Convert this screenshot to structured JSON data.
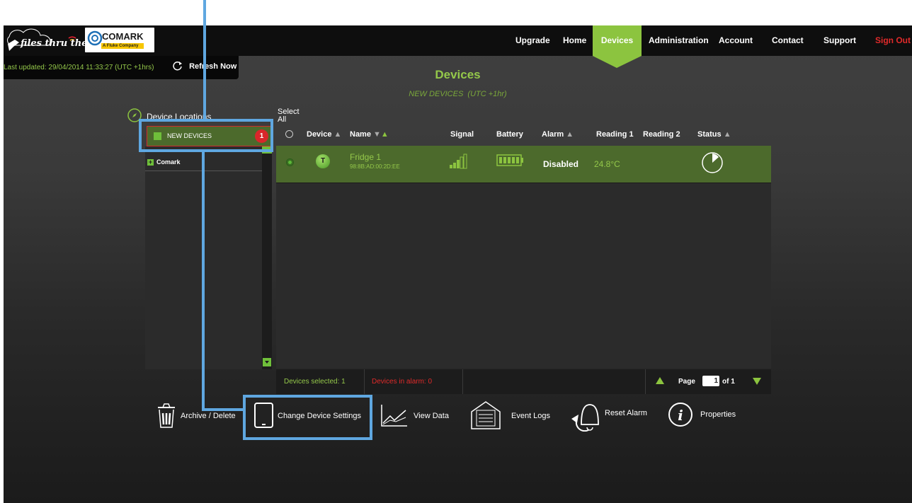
{
  "brand": {
    "logo_text": "files thru the air",
    "comark_name": "COMARK",
    "comark_sub": "A Fluke Company"
  },
  "nav": {
    "items": [
      "Upgrade",
      "Home",
      "Devices",
      "Administration",
      "Account",
      "Contact",
      "Support",
      "Sign Out"
    ],
    "active": "Devices"
  },
  "status": {
    "last_updated": "Last updated: 29/04/2014 11:33:27 (UTC +1hrs)",
    "refresh": "Refresh Now"
  },
  "page": {
    "title": "Devices",
    "subtitle": "NEW DEVICES  (UTC +1hr)"
  },
  "locations": {
    "heading": "Device Locations",
    "new_devices": "NEW DEVICES",
    "new_count": "1",
    "tree": [
      "Comark"
    ]
  },
  "table": {
    "select_all": "Select All",
    "headers": {
      "device": "Device",
      "name": "Name",
      "signal": "Signal",
      "battery": "Battery",
      "alarm": "Alarm",
      "reading1": "Reading 1",
      "reading2": "Reading 2",
      "status": "Status"
    },
    "rows": [
      {
        "device_letter": "T",
        "name": "Fridge 1",
        "mac": "98:8B:AD:00:2D:EE",
        "alarm": "Disabled",
        "reading1": "24.8°C",
        "reading2": ""
      }
    ]
  },
  "footer": {
    "selected": "Devices selected: 1",
    "alarms": "Devices in alarm: 0",
    "page_label": "Page",
    "page_value": "1",
    "page_of": "of 1"
  },
  "actions": {
    "archive": "Archive / Delete",
    "change": "Change Device Settings",
    "view": "View Data",
    "events": "Event Logs",
    "reset": "Reset Alarm",
    "properties": "Properties"
  },
  "colors": {
    "accent": "#94c84a",
    "active_nav": "#8cc43f",
    "alarm_red": "#e02a2a",
    "annotation": "#5fa7e0"
  }
}
